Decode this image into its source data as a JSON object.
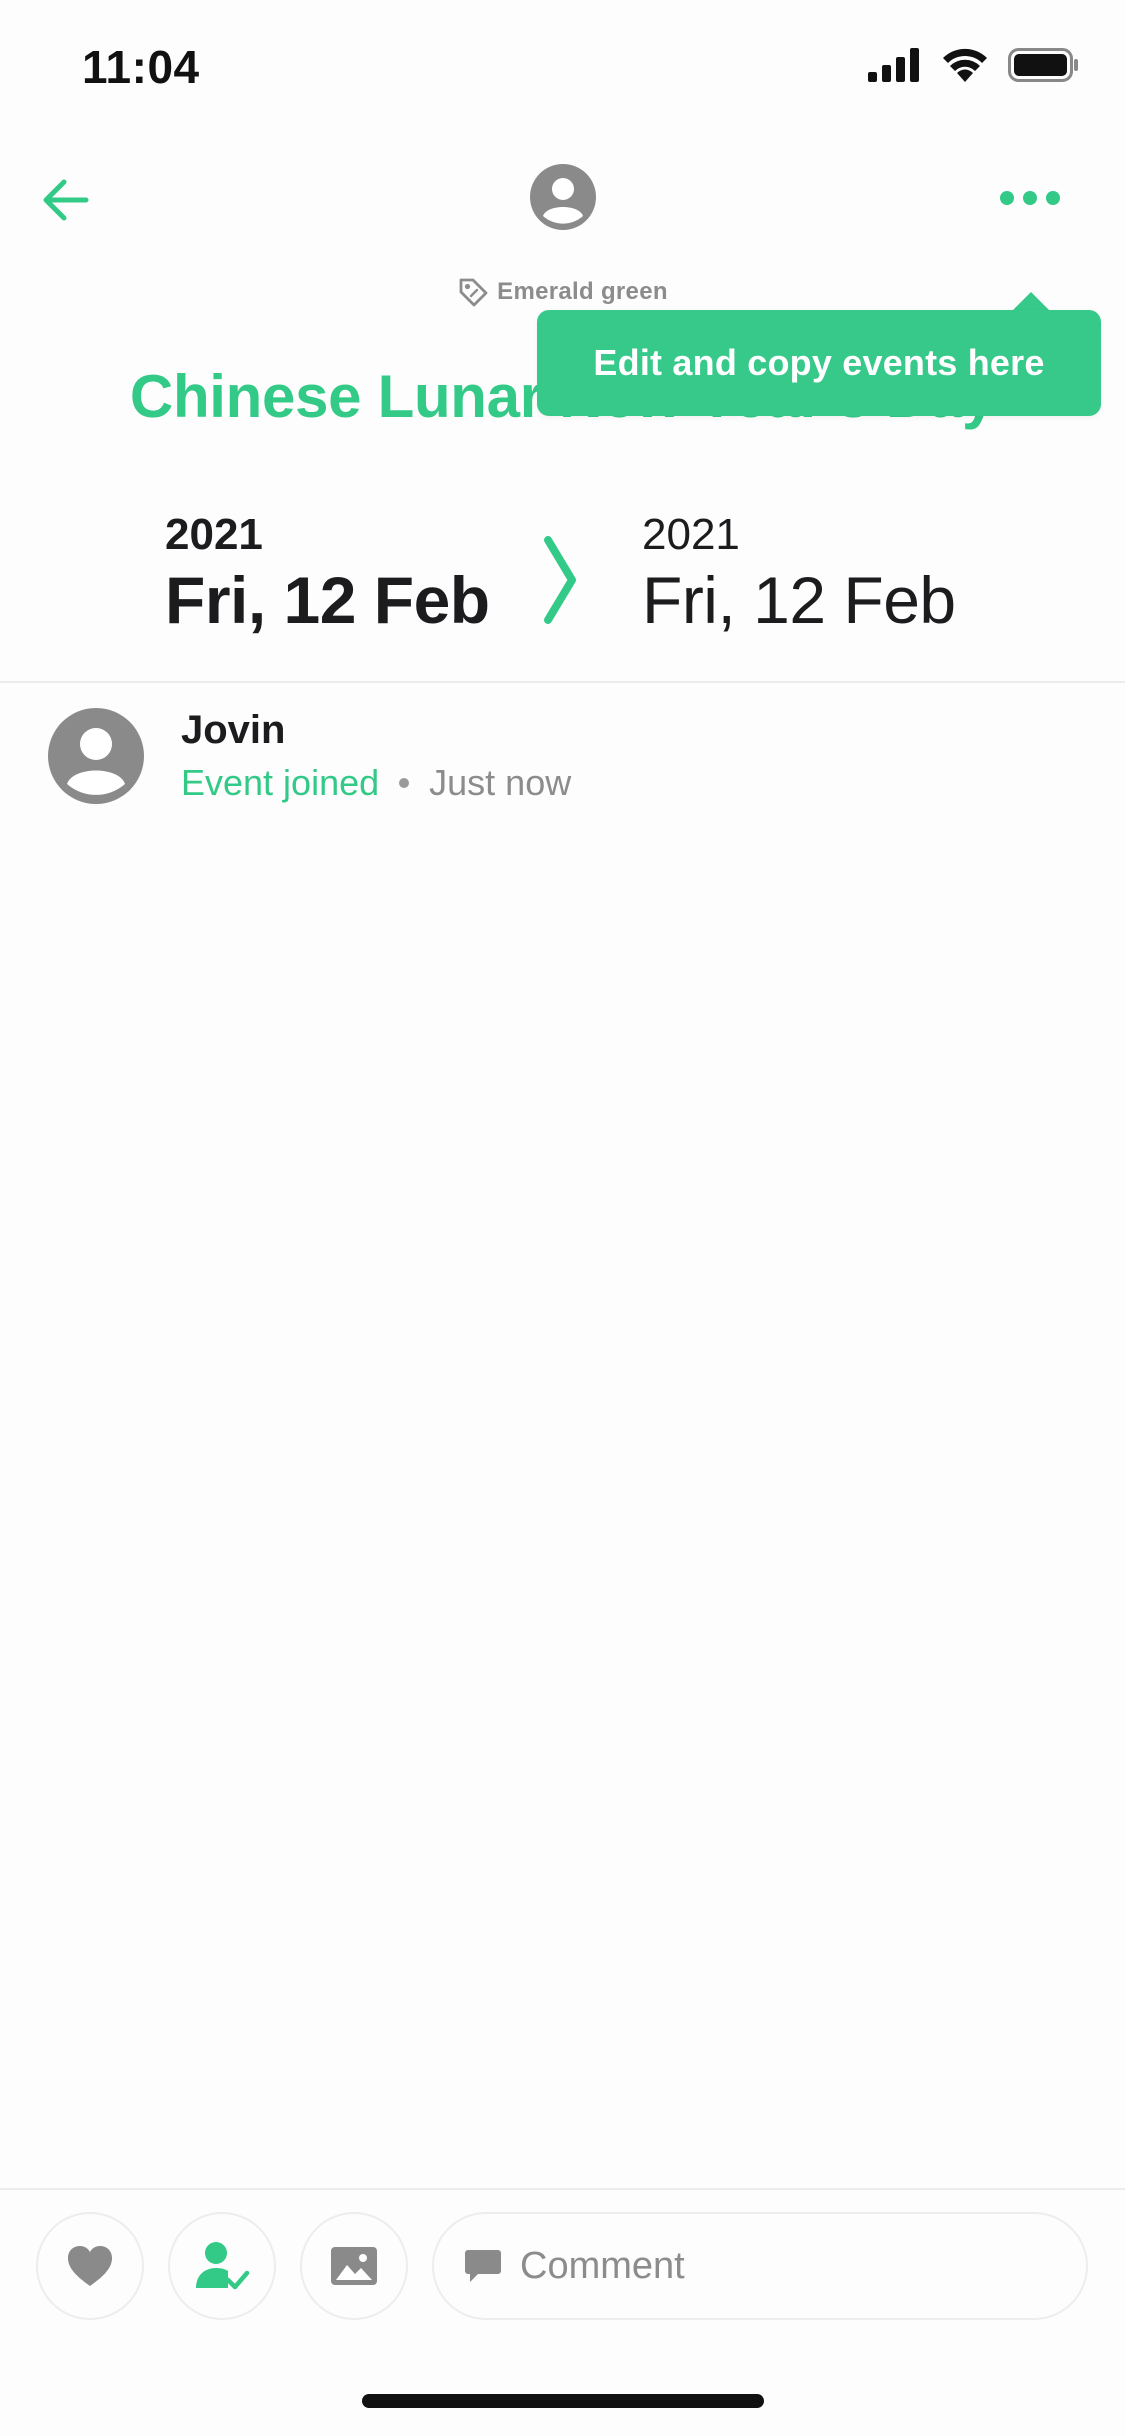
{
  "status_bar": {
    "time": "11:04",
    "icons": [
      "cellular-signal-icon",
      "wifi-icon",
      "battery-icon"
    ]
  },
  "nav": {
    "back_icon": "arrow-left-icon",
    "avatar_icon": "user-avatar-icon",
    "more_icon": "more-dots-icon"
  },
  "event": {
    "label": "Emerald green",
    "label_icon": "tag-icon",
    "title": "Chinese Lunar New Year's Day",
    "start": {
      "year": "2021",
      "date": "Fri, 12 Feb"
    },
    "end": {
      "year": "2021",
      "date": "Fri, 12 Feb"
    }
  },
  "tooltip": {
    "text": "Edit and copy events here"
  },
  "activity": [
    {
      "name": "Jovin",
      "status": "Event joined",
      "time": "Just now"
    }
  ],
  "actions": {
    "like_icon": "heart-icon",
    "join_icon": "user-check-icon",
    "photo_icon": "image-icon",
    "comment_icon": "speech-bubble-icon",
    "comment_placeholder": "Comment"
  },
  "colors": {
    "accent": "#33c987",
    "tooltip": "#36c98a",
    "muted": "#8c8c8c",
    "icon_gray": "#8a8a8a"
  }
}
